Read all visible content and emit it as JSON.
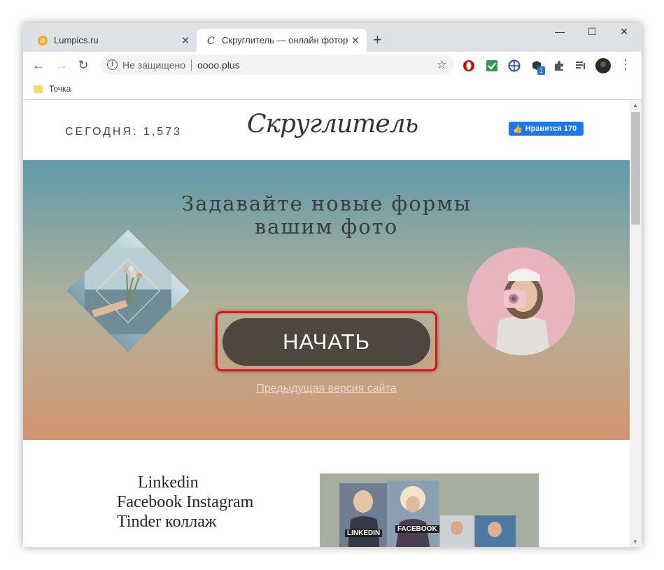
{
  "browser": {
    "tabs": [
      {
        "title": "Lumpics.ru",
        "active": false
      },
      {
        "title": "Скруглитель — онлайн фоторедактор",
        "active": true
      }
    ],
    "new_tab_label": "+",
    "window_controls": {
      "minimize": "—",
      "maximize": "☐",
      "close": "✕"
    },
    "address": {
      "security_label": "Не защищено",
      "url": "oooo.plus"
    },
    "extension_badge": "1",
    "bookmarks": [
      {
        "label": "Точка",
        "type": "folder"
      }
    ],
    "colors": {
      "tabbar": "#dee1e6",
      "omnibox": "#f1f3f4",
      "accent": "#1877f2"
    }
  },
  "site": {
    "today_label": "СЕГОДНЯ: 1,573",
    "logo": "Скруглитель",
    "like_button": {
      "label": "Нравится",
      "count": "170"
    },
    "hero": {
      "title_line1": "Задавайте новые формы",
      "title_line2": "вашим фото",
      "start_button": "НАЧАТЬ",
      "previous_version_link": "Предыдущая версия сайта"
    },
    "social": {
      "line1": "Linkedin",
      "line2": "Facebook Instagram",
      "line3": "Tinder коллаж",
      "collage_labels": [
        "LINKEDIN",
        "FACEBOOK"
      ]
    }
  }
}
